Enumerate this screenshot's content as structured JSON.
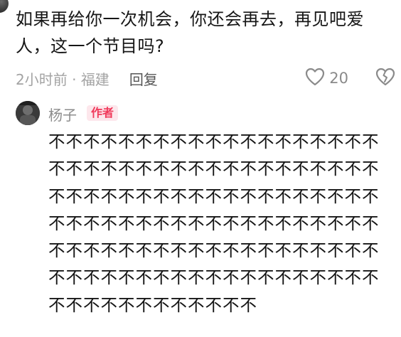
{
  "comment": {
    "text": "如果再给你一次机会，你还会再去，再见吧爱人，这一个节目吗?",
    "time": "2小时前",
    "separator": "·",
    "location": "福建",
    "reply_label": "回复",
    "like_count": "20"
  },
  "reply": {
    "username": "杨子",
    "badge": "作者",
    "text": "不不不不不不不不不不不不不不不不不不不不不不不不不不不不不不不不不不不不不不不不不不不不不不不不不不不不不不不不不不不不不不不不不不不不不不不不不不不不不不不不不不不不不不不不不不不不不不不不不不不不不不不不不不不不不不不不不不不不不不不不不不不不不不"
  },
  "colors": {
    "badge_bg": "#fde7ec",
    "badge_text": "#f0395a",
    "meta_text": "#9a9a9a"
  },
  "icons": {
    "like": "heart-outline-icon",
    "dislike": "broken-heart-icon"
  }
}
